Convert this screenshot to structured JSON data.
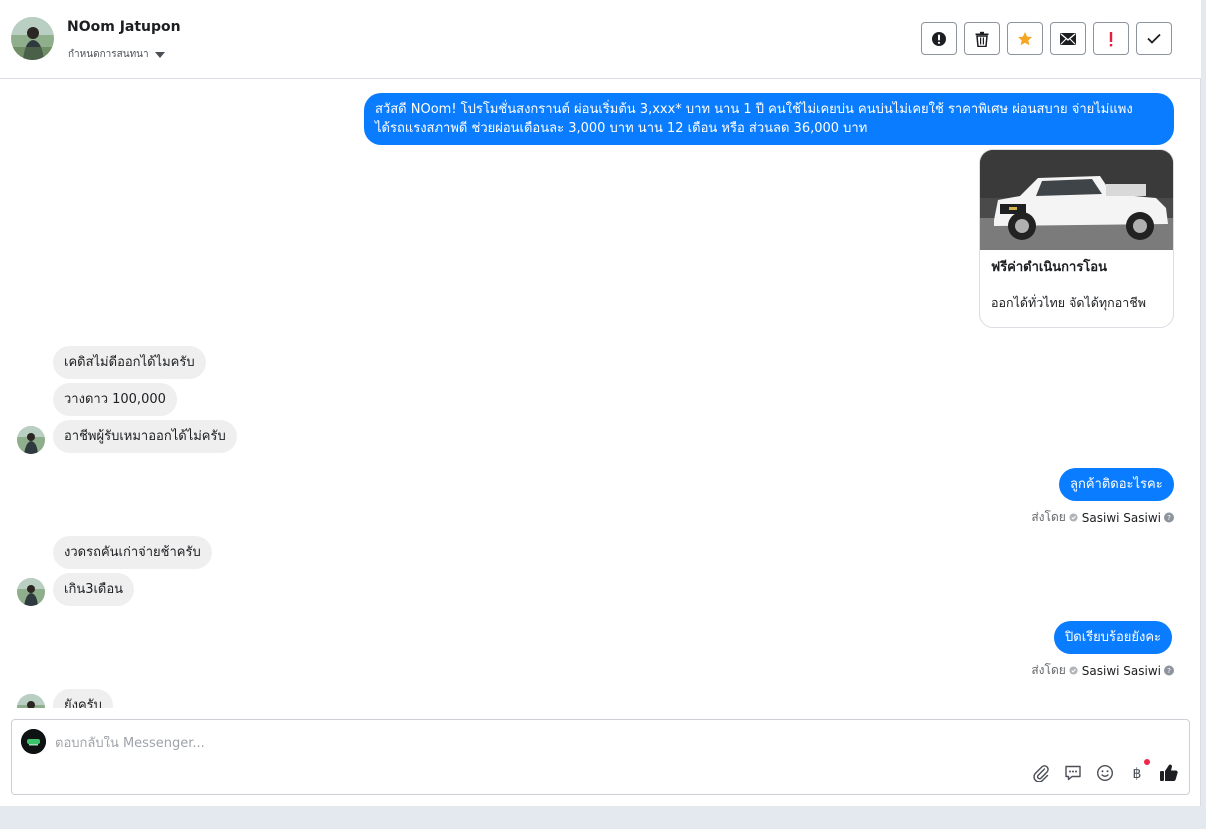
{
  "header": {
    "contact_name": "NOom Jatupon",
    "assign_label": "กำหนดการสนทนา",
    "actions": [
      {
        "name": "spam-button",
        "icon": "exclamation-circle-icon"
      },
      {
        "name": "delete-button",
        "icon": "trash-icon"
      },
      {
        "name": "star-button",
        "icon": "star-icon"
      },
      {
        "name": "mark-unread-button",
        "icon": "envelope-icon"
      },
      {
        "name": "follow-up-button",
        "icon": "exclamation-icon"
      },
      {
        "name": "mark-done-button",
        "icon": "check-icon"
      }
    ]
  },
  "thread": {
    "msg1_line1": "สวัสดี NOom! โปรโมชั่นสงกรานต์ ผ่อนเริ่มต้น 3,xxx* บาท นาน 1 ปี คนใช้ไม่เคยบ่น คนบ่นไม่เคยใช้  ราคาพิเศษ ผ่อนสบาย จ่ายไม่แพง",
    "msg1_line2": "ได้รถแรงสภาพดี ช่วยผ่อนเดือนละ 3,000 บาท นาน 12 เดือน หรือ ส่วนลด 36,000 บาท",
    "card_title": "ฟรีค่าดำเนินการโอน",
    "card_subtitle": "ออกได้ทั่วไทย จัดได้ทุกอาชีพ",
    "in1": "เคดิสไม่ดีออกได้ไมครับ",
    "in2": "วางดาว 100,000",
    "in3": "อาชีพผู้รับเหมาออกได้ไม่ครับ",
    "out2": "ลูกค้าติดอะไรคะ",
    "in4": "งวดรถคันเก่าจ่ายช้าครับ",
    "in5": "เกิน3เดือน",
    "out3": "ปิดเรียบร้อยยังคะ",
    "in6": "ยังครับ",
    "sent_by_label": "ส่งโดย",
    "sent_by_name": "Sasiwi Sasiwi"
  },
  "composer": {
    "placeholder": "ตอบกลับใน Messenger...",
    "tools": [
      "paperclip-icon",
      "saved-replies-icon",
      "emoji-icon",
      "baht-icon",
      "thumbs-up-icon"
    ]
  },
  "colors": {
    "outgoing_bubble": "#0a7cff",
    "incoming_bubble": "#efefef",
    "star": "#f5a623",
    "alert_red": "#e41e3f"
  }
}
